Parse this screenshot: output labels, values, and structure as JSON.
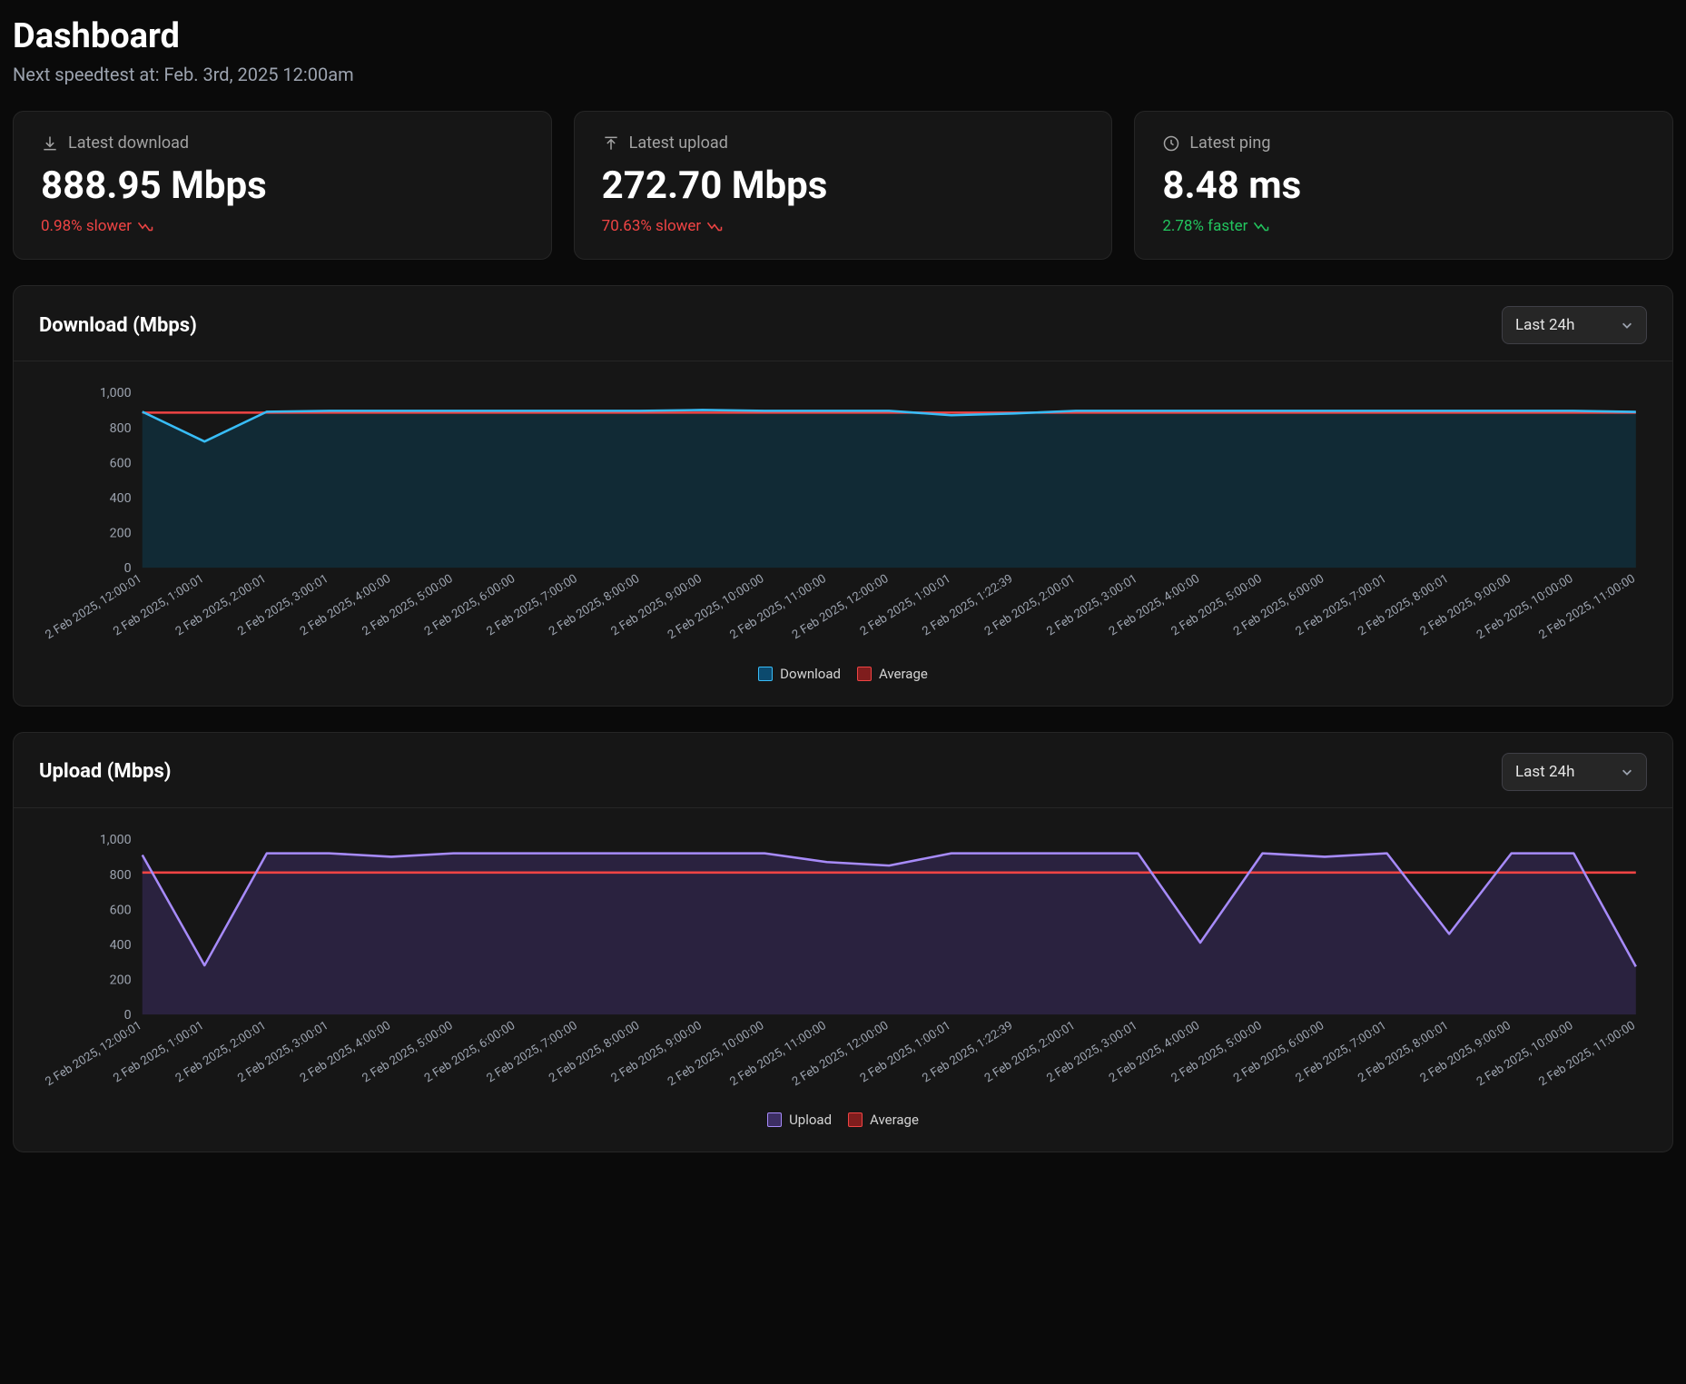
{
  "header": {
    "title": "Dashboard",
    "subtitle": "Next speedtest at: Feb. 3rd, 2025 12:00am"
  },
  "stats": {
    "download": {
      "label": "Latest download",
      "value": "888.95 Mbps",
      "delta": "0.98% slower",
      "direction": "down"
    },
    "upload": {
      "label": "Latest upload",
      "value": "272.70 Mbps",
      "delta": "70.63% slower",
      "direction": "down"
    },
    "ping": {
      "label": "Latest ping",
      "value": "8.48 ms",
      "delta": "2.78% faster",
      "direction": "up"
    }
  },
  "range_selector": {
    "selected": "Last 24h"
  },
  "chart_data": [
    {
      "type": "line",
      "title": "Download (Mbps)",
      "ylabel": "",
      "xlabel": "",
      "ylim": [
        0,
        1000
      ],
      "yticks": [
        0,
        200,
        400,
        600,
        800,
        1000
      ],
      "categories": [
        "2 Feb 2025, 12:00:01",
        "2 Feb 2025, 1:00:01",
        "2 Feb 2025, 2:00:01",
        "2 Feb 2025, 3:00:01",
        "2 Feb 2025, 4:00:00",
        "2 Feb 2025, 5:00:00",
        "2 Feb 2025, 6:00:00",
        "2 Feb 2025, 7:00:00",
        "2 Feb 2025, 8:00:00",
        "2 Feb 2025, 9:00:00",
        "2 Feb 2025, 10:00:00",
        "2 Feb 2025, 11:00:00",
        "2 Feb 2025, 12:00:00",
        "2 Feb 2025, 1:00:01",
        "2 Feb 2025, 1:22:39",
        "2 Feb 2025, 2:00:01",
        "2 Feb 2025, 3:00:01",
        "2 Feb 2025, 4:00:00",
        "2 Feb 2025, 5:00:00",
        "2 Feb 2025, 6:00:00",
        "2 Feb 2025, 7:00:01",
        "2 Feb 2025, 8:00:01",
        "2 Feb 2025, 9:00:00",
        "2 Feb 2025, 10:00:00",
        "2 Feb 2025, 11:00:00"
      ],
      "series": [
        {
          "name": "Download",
          "color": "#38bdf8",
          "values": [
            890,
            720,
            890,
            895,
            895,
            895,
            895,
            895,
            895,
            900,
            895,
            895,
            895,
            870,
            880,
            895,
            895,
            895,
            895,
            895,
            895,
            895,
            895,
            895,
            889
          ]
        },
        {
          "name": "Average",
          "color": "#ef4444",
          "values": [
            885,
            885,
            885,
            885,
            885,
            885,
            885,
            885,
            885,
            885,
            885,
            885,
            885,
            885,
            885,
            885,
            885,
            885,
            885,
            885,
            885,
            885,
            885,
            885,
            885
          ]
        }
      ],
      "legend": [
        "Download",
        "Average"
      ]
    },
    {
      "type": "line",
      "title": "Upload (Mbps)",
      "ylabel": "",
      "xlabel": "",
      "ylim": [
        0,
        1000
      ],
      "yticks": [
        0,
        200,
        400,
        600,
        800,
        1000
      ],
      "categories": [
        "2 Feb 2025, 12:00:01",
        "2 Feb 2025, 1:00:01",
        "2 Feb 2025, 2:00:01",
        "2 Feb 2025, 3:00:01",
        "2 Feb 2025, 4:00:00",
        "2 Feb 2025, 5:00:00",
        "2 Feb 2025, 6:00:00",
        "2 Feb 2025, 7:00:00",
        "2 Feb 2025, 8:00:00",
        "2 Feb 2025, 9:00:00",
        "2 Feb 2025, 10:00:00",
        "2 Feb 2025, 11:00:00",
        "2 Feb 2025, 12:00:00",
        "2 Feb 2025, 1:00:01",
        "2 Feb 2025, 1:22:39",
        "2 Feb 2025, 2:00:01",
        "2 Feb 2025, 3:00:01",
        "2 Feb 2025, 4:00:00",
        "2 Feb 2025, 5:00:00",
        "2 Feb 2025, 6:00:00",
        "2 Feb 2025, 7:00:01",
        "2 Feb 2025, 8:00:01",
        "2 Feb 2025, 9:00:00",
        "2 Feb 2025, 10:00:00",
        "2 Feb 2025, 11:00:00"
      ],
      "series": [
        {
          "name": "Upload",
          "color": "#a78bfa",
          "values": [
            910,
            280,
            920,
            920,
            900,
            920,
            920,
            920,
            920,
            920,
            920,
            870,
            850,
            920,
            920,
            920,
            920,
            410,
            920,
            900,
            920,
            460,
            920,
            920,
            273
          ]
        },
        {
          "name": "Average",
          "color": "#ef4444",
          "values": [
            810,
            810,
            810,
            810,
            810,
            810,
            810,
            810,
            810,
            810,
            810,
            810,
            810,
            810,
            810,
            810,
            810,
            810,
            810,
            810,
            810,
            810,
            810,
            810,
            810
          ]
        }
      ],
      "legend": [
        "Upload",
        "Average"
      ]
    }
  ]
}
